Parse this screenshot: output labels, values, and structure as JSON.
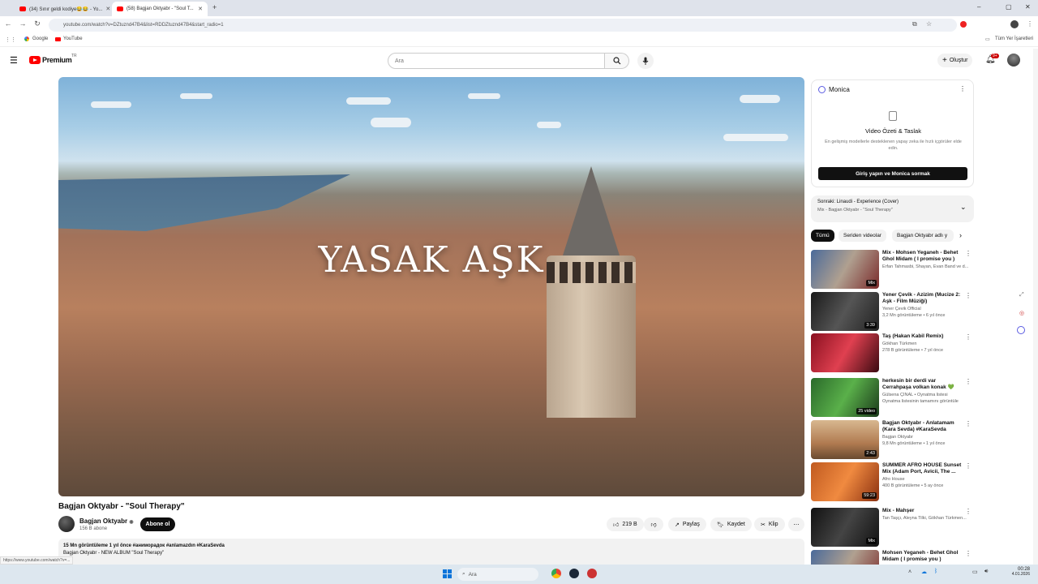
{
  "browser": {
    "tabs": [
      {
        "label": "(34) Sınır geldi kodiye😂😂 - Yo..."
      },
      {
        "label": "(58) Bagjan Oktyabr - \"Soul T..."
      }
    ],
    "url": "youtube.com/watch?v=DZtuznd47B4&list=RDDZtuznd47B4&start_radio=1",
    "bookmarks": [
      "Google",
      "YouTube"
    ],
    "all_bookmarks": "Tüm Yer İşaretleri"
  },
  "yt": {
    "logo_text": "Premium",
    "logo_sup": "TR",
    "search_placeholder": "Ara",
    "create_label": "Oluştur",
    "notif_count": "9+"
  },
  "video": {
    "overlay_text": "YASAK AŞK",
    "title": "Bagjan Oktyabr - \"Soul Therapy\"",
    "channel": "Bagjan Oktyabr",
    "subscribers": "156 B abone",
    "subscribe_label": "Abone ol",
    "likes": "219 B",
    "share": "Paylaş",
    "save": "Kaydet",
    "clip": "Klip",
    "desc_line1": "15 Mn görüntüleme  1 yıl önce  #аниморадок #anlamazdın #KaraSevda",
    "desc_line2": "Bagjan Oktyabr - NEW ALBUM \"Soul Therapy\""
  },
  "monica": {
    "name": "Monica",
    "heading": "Video Özeti & Taslak",
    "text": "En gelişmiş modellerle desteklenen yapay zeka ile hızlı içgörüler elde edin.",
    "button": "Giriş yapın ve Monica sormak"
  },
  "upnext": {
    "label": "Sonraki: Linaudi - Experience (Cover)",
    "sub": "Mix - Bagjan Oktyabr - \"Soul Therapy\""
  },
  "chips": [
    "Tümü",
    "Seriden videolar",
    "Bagjan Oktyabr adlı y"
  ],
  "recs": [
    {
      "title": "Mix - Mohsen Yeganeh - Behet Ghol Midam ( I promise you )",
      "meta1": "Erfan Tahmasbi, Shayan, Evan Band ve d...",
      "meta2": "",
      "badge": "Mix"
    },
    {
      "title": "Yener Çevik - Azizim (Mucize 2: Aşk - Film Müziği)",
      "meta1": "Yener Çevik Official",
      "meta2": "3,2 Mn görüntüleme • 6 yıl önce",
      "badge": "3:39"
    },
    {
      "title": "Taş (Hakan Kabil Remix)",
      "meta1": "Gökhan Türkmen",
      "meta2": "278 B görüntüleme • 7 yıl önce",
      "badge": ""
    },
    {
      "title": "herkesin bir derdi var Cerrahpaşa volkan konak 💚",
      "meta1": "Gülsena ÇINAL • Oynatma listesi",
      "meta2": "Oynatma listesinin tamamını görüntüle",
      "badge": "25 video"
    },
    {
      "title": "Bagjan Oktyabr - Anlatamam (Kara Sevda) #KaraSevda",
      "meta1": "Bagjan Oktyabr",
      "meta2": "9,8 Mn görüntüleme • 1 yıl önce",
      "badge": "2:43"
    },
    {
      "title": "SUMMER AFRO HOUSE Sunset Mix (Adam Port, Avicii, The ...",
      "meta1": "Afro House",
      "meta2": "400 B görüntüleme • 5 ay önce",
      "badge": "59:23"
    },
    {
      "title": "Mix - Mahşer",
      "meta1": "Tan Taşçı, Aleyna Tilki, Gökhan Türkmen...",
      "meta2": "",
      "badge": "Mix"
    },
    {
      "title": "Mohsen Yeganeh - Behet Ghol Midam ( I promise you )",
      "meta1": "",
      "meta2": "",
      "badge": ""
    }
  ],
  "taskbar": {
    "search": "Ara",
    "time": "00:28",
    "date": "4.01.2026"
  },
  "status_url": "https://www.youtube.com/watch?v=..."
}
